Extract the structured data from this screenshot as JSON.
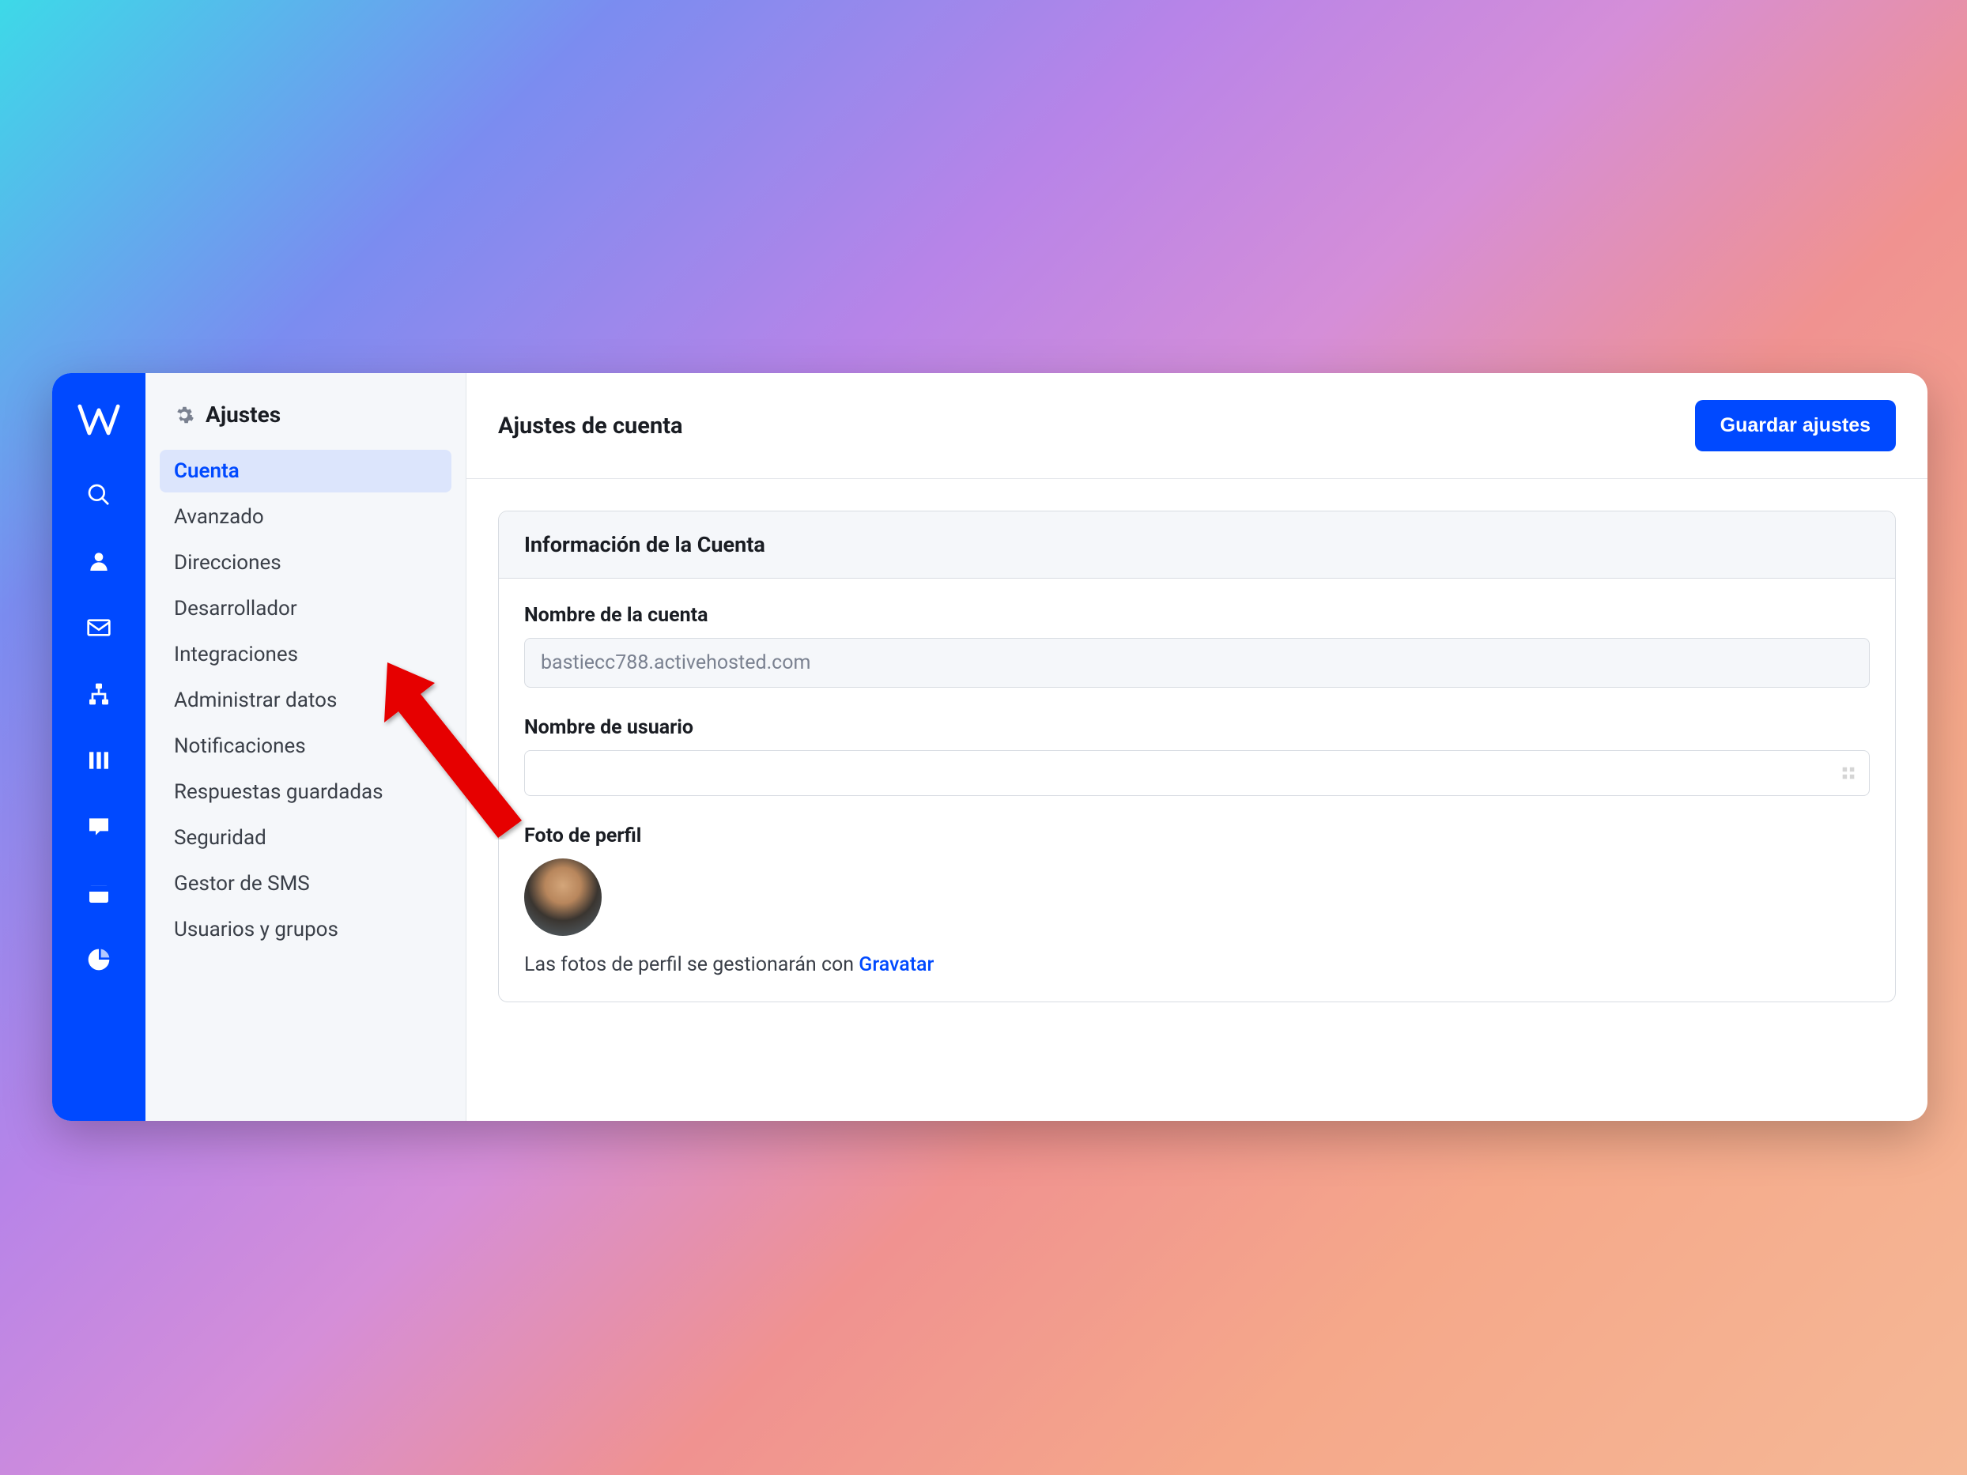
{
  "sidebar": {
    "title": "Ajustes",
    "items": [
      {
        "label": "Cuenta",
        "active": true
      },
      {
        "label": "Avanzado"
      },
      {
        "label": "Direcciones"
      },
      {
        "label": "Desarrollador"
      },
      {
        "label": "Integraciones"
      },
      {
        "label": "Administrar datos"
      },
      {
        "label": "Notificaciones"
      },
      {
        "label": "Respuestas guardadas"
      },
      {
        "label": "Seguridad"
      },
      {
        "label": "Gestor de SMS"
      },
      {
        "label": "Usuarios y grupos"
      }
    ]
  },
  "header": {
    "title": "Ajustes de cuenta",
    "save_label": "Guardar ajustes"
  },
  "card": {
    "title": "Información de la Cuenta",
    "account_name_label": "Nombre de la cuenta",
    "account_name_value": "bastiecc788.activehosted.com",
    "username_label": "Nombre de usuario",
    "username_value": "",
    "profile_label": "Foto de perfil",
    "profile_text": "Las fotos de perfil se gestionarán con ",
    "profile_link": "Gravatar"
  },
  "iconbar_icons": [
    "search-icon",
    "person-icon",
    "mail-icon",
    "flow-icon",
    "pipeline-icon",
    "chat-icon",
    "calendar-icon",
    "chart-icon"
  ]
}
